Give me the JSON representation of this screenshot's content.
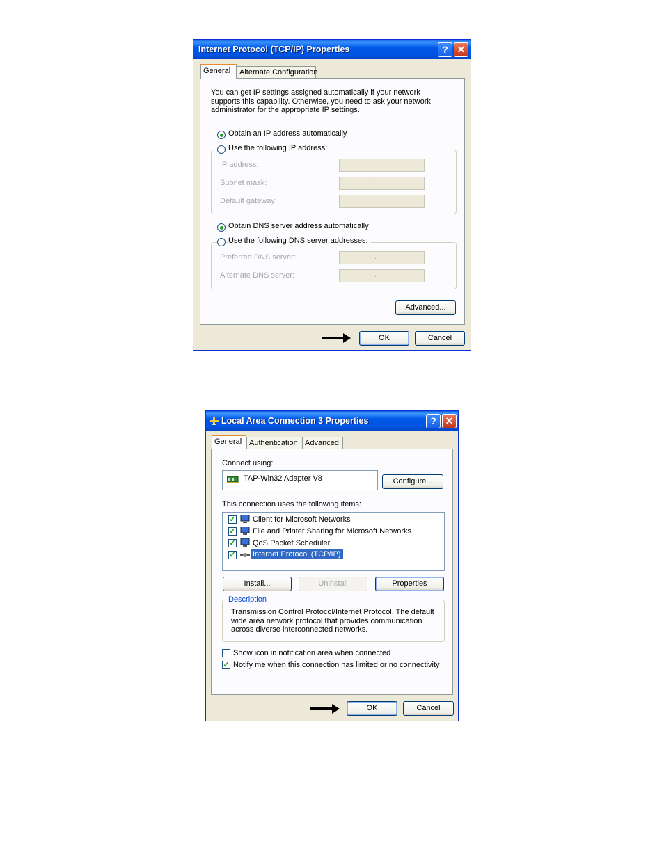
{
  "tcpip": {
    "title": "Internet Protocol (TCP/IP) Properties",
    "help": "?",
    "close": "✕",
    "tabs": [
      "General",
      "Alternate Configuration"
    ],
    "intro": "You can get IP settings assigned automatically if your network supports this capability. Otherwise, you need to ask your network administrator for the appropriate IP settings.",
    "ip_auto": "Obtain an IP address automatically",
    "ip_manual": "Use the following IP address:",
    "ip_address": "IP address:",
    "subnet": "Subnet mask:",
    "gateway": "Default gateway:",
    "dns_auto": "Obtain DNS server address automatically",
    "dns_manual": "Use the following DNS server addresses:",
    "preferred_dns": "Preferred DNS server:",
    "alternate_dns": "Alternate DNS server:",
    "ip_placeholder": "...",
    "advanced": "Advanced...",
    "ok": "OK",
    "cancel": "Cancel"
  },
  "lan": {
    "title": "Local Area Connection 3 Properties",
    "help": "?",
    "close": "✕",
    "tabs": [
      "General",
      "Authentication",
      "Advanced"
    ],
    "connect_using": "Connect using:",
    "adapter": "TAP-Win32 Adapter V8",
    "configure": "Configure...",
    "items_label": "This connection uses the following items:",
    "items": [
      {
        "label": "Client for Microsoft Networks",
        "checked": true
      },
      {
        "label": "File and Printer Sharing for Microsoft Networks",
        "checked": true
      },
      {
        "label": "QoS Packet Scheduler",
        "checked": true
      },
      {
        "label": "Internet Protocol (TCP/IP)",
        "checked": true
      }
    ],
    "install": "Install...",
    "uninstall": "Uninstall",
    "properties": "Properties",
    "description_title": "Description",
    "description": "Transmission Control Protocol/Internet Protocol. The default wide area network protocol that provides communication across diverse interconnected networks.",
    "show_icon": "Show icon in notification area when connected",
    "notify": "Notify me when this connection has limited or no connectivity",
    "check_mark": "✓",
    "ok": "OK",
    "cancel": "Cancel"
  }
}
